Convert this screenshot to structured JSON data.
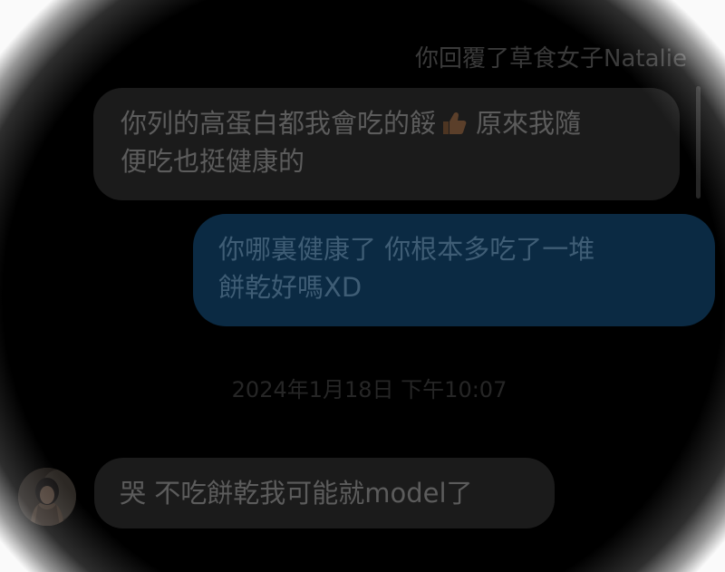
{
  "conversation": {
    "reply_header": "你回覆了草食女子Natalie",
    "quoted_message": {
      "text_before_emoji": "你列的高蛋白都我會吃的餒",
      "emoji": "thumbs-up-icon",
      "text_after_emoji_line1": "原來我隨",
      "text_line2": "便吃也挺健康的"
    },
    "sent_message": {
      "line1": "你哪裏健康了 你根本多吃了一堆",
      "line2": "餅乾好嗎XD"
    },
    "timestamp": "2024年1月18日 下午10:07",
    "received_message": {
      "text": "哭 不吃餅乾我可能就model了",
      "avatar": "avatar-photo"
    }
  },
  "colors": {
    "background": "#000000",
    "incoming_bubble": "#1b1b1b",
    "outgoing_bubble": "#0b2a43",
    "incoming_text": "#5c5c5c",
    "outgoing_text": "#3f5d75"
  }
}
